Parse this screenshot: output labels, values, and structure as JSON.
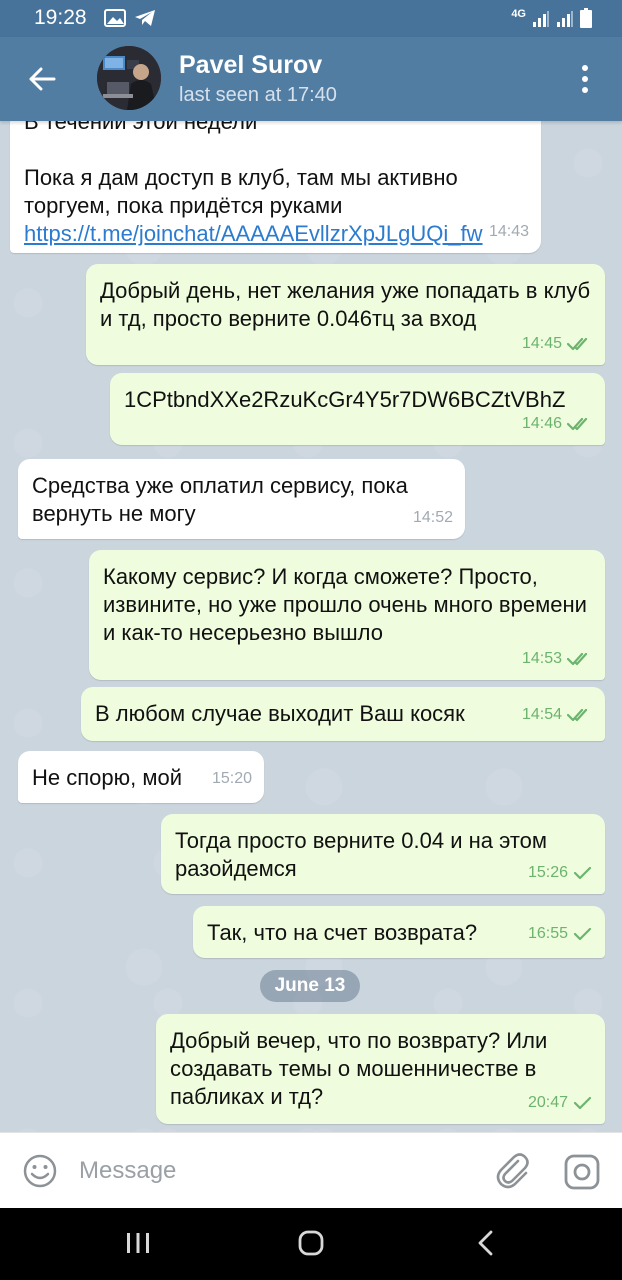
{
  "status_bar": {
    "time": "19:28",
    "network": "4G"
  },
  "header": {
    "name": "Pavel Surov",
    "status": "last seen at 17:40"
  },
  "messages": [
    {
      "dir": "in",
      "text": "В течении этой недели\n\nПока я дам доступ в клуб, там мы активно торгуем, пока придётся руками ",
      "link": "https://t.me/joinchat/AAAAAEvllzrXpJLgUQi_fw",
      "time": "14:43"
    },
    {
      "dir": "out",
      "text": "Добрый день, нет желания уже попадать в клуб и тд, просто верните 0.046тц за вход",
      "time": "14:45",
      "read": true
    },
    {
      "dir": "out",
      "text": "1CPtbndXXe2RzuKcGr4Y5r7DW6BCZtVBhZ",
      "time": "14:46",
      "read": true
    },
    {
      "dir": "in",
      "text": "Средства уже оплатил сервису, пока вернуть не могу",
      "time": "14:52"
    },
    {
      "dir": "out",
      "text": "Какому сервис? И когда сможете? Просто, извините, но уже прошло очень много времени и как-то несерьезно вышло",
      "time": "14:53",
      "read": true
    },
    {
      "dir": "out",
      "text": "В любом случае выходит Ваш косяк",
      "time": "14:54",
      "read": true
    },
    {
      "dir": "in",
      "text": "Не спорю, мой",
      "time": "15:20"
    },
    {
      "dir": "out",
      "text": "Тогда просто верните 0.04 и на этом разойдемся",
      "time": "15:26",
      "read": false
    },
    {
      "dir": "out",
      "text": "Так, что на счет возврата?",
      "time": "16:55",
      "read": false
    },
    {
      "dir": "out",
      "text": "Добрый вечер, что по возврату? Или создавать темы о мошенничестве в пабликах и тд?",
      "time": "20:47",
      "read": false
    }
  ],
  "date_divider": "June 13",
  "composer": {
    "placeholder": "Message"
  },
  "colors": {
    "header": "#527da3",
    "status_bar": "#47739b",
    "outgoing": "#effdde",
    "incoming": "#ffffff",
    "check": "#6cb46e",
    "link": "#2b7bd0"
  },
  "icons": {
    "back": "arrow-left-icon",
    "menu": "more-vert-icon",
    "emoji": "emoji-icon",
    "attach": "paperclip-icon",
    "camera": "instagram-camera-icon"
  }
}
